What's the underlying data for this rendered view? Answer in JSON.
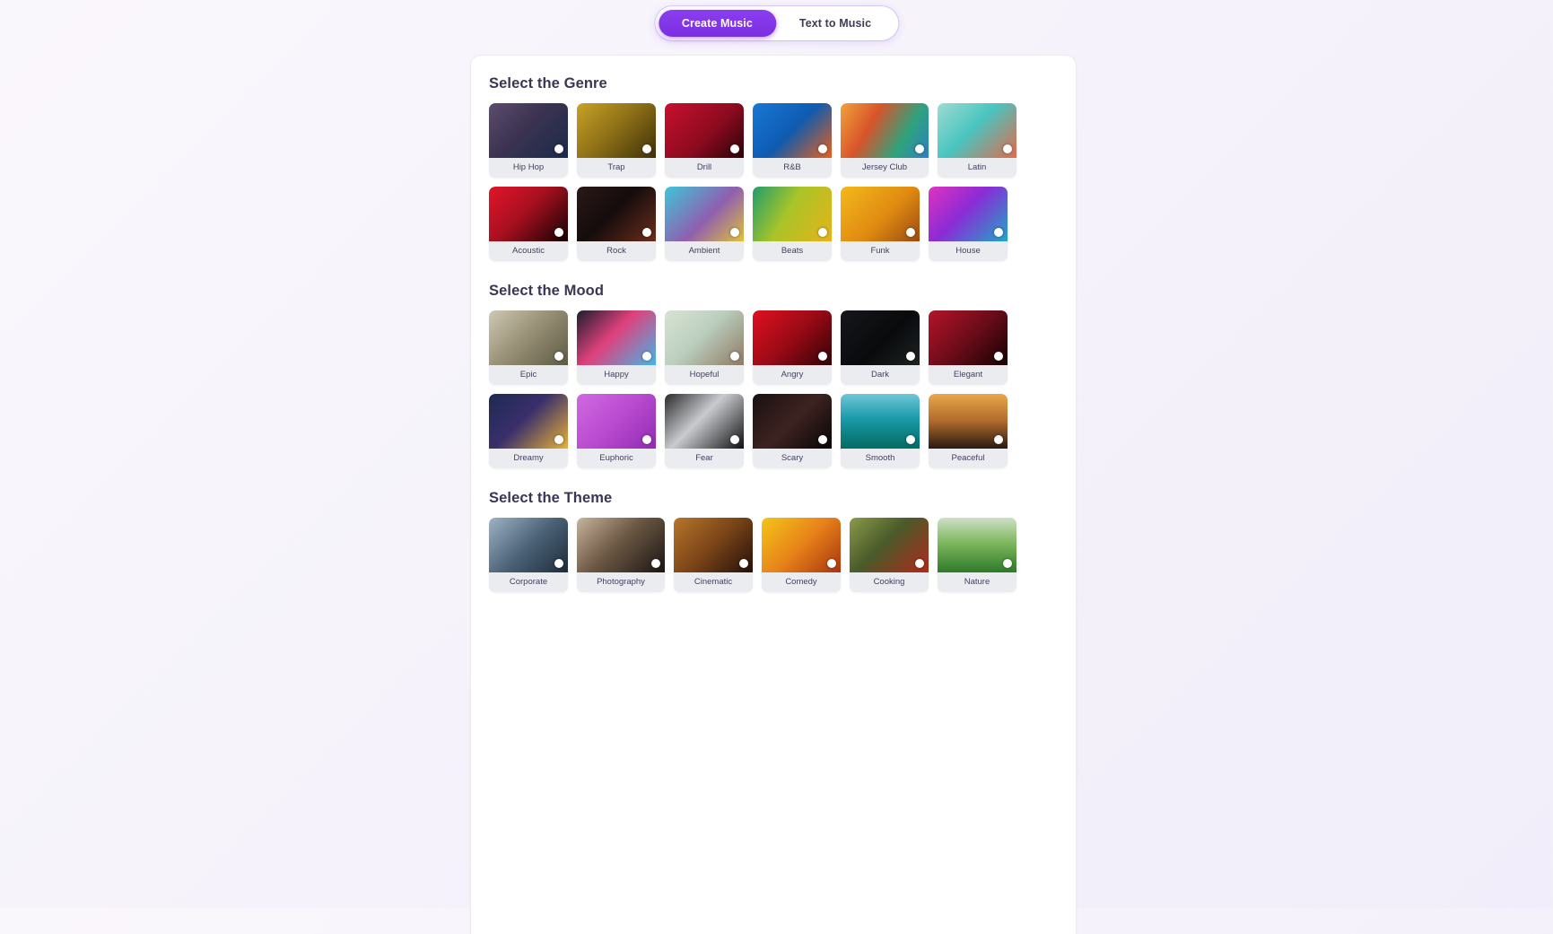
{
  "toggle": {
    "options": [
      {
        "label": "Create Music",
        "active": true
      },
      {
        "label": "Text to Music",
        "active": false
      }
    ]
  },
  "sections": [
    {
      "id": "genre",
      "title": "Select the Genre",
      "items": [
        {
          "label": "Hip Hop",
          "art": "linear-gradient(135deg,#5d4b6e 0%,#3b3350 45%,#1b2a4a 100%)"
        },
        {
          "label": "Trap",
          "art": "linear-gradient(135deg,#c9a227 0%,#8a6d16 50%,#3d3008 100%)"
        },
        {
          "label": "Drill",
          "art": "linear-gradient(135deg,#c8102e 0%,#8d0b1f 55%,#2b0209 100%)"
        },
        {
          "label": "R&B",
          "art": "linear-gradient(135deg,#1877d6 0%,#0f5bb0 50%,#e8601c 100%)"
        },
        {
          "label": "Jersey Club",
          "art": "linear-gradient(120deg,#f0a23c 0%,#d8542a 35%,#2fa37c 70%,#2f7fc0 100%)"
        },
        {
          "label": "Latin",
          "art": "linear-gradient(135deg,#9ddcd2 0%,#49c4c0 45%,#e26a4a 100%)"
        },
        {
          "label": "Acoustic",
          "art": "linear-gradient(135deg,#e2152a 0%,#a8101f 45%,#140103 100%)"
        },
        {
          "label": "Rock",
          "art": "linear-gradient(135deg,#2a1a18 0%,#140c0c 45%,#6b2d1c 100%)"
        },
        {
          "label": "Ambient",
          "art": "linear-gradient(135deg,#3ec6d8 0%,#8f5fb0 55%,#e0c13a 100%)"
        },
        {
          "label": "Beats",
          "art": "linear-gradient(120deg,#1f9e6a 0%,#a9c428 45%,#e8b21a 100%)"
        },
        {
          "label": "Funk",
          "art": "linear-gradient(135deg,#f4b91a 0%,#e08a12 55%,#9a4a10 100%)"
        },
        {
          "label": "House",
          "art": "linear-gradient(135deg,#e033c0 0%,#8a2bd6 45%,#1fa8c8 100%)"
        }
      ]
    },
    {
      "id": "mood",
      "title": "Select the Mood",
      "items": [
        {
          "label": "Epic",
          "art": "linear-gradient(135deg,#cfc9b4 0%,#9a9278 45%,#5d5a44 100%)"
        },
        {
          "label": "Happy",
          "art": "linear-gradient(135deg,#1b1d2e 0%,#e0417c 45%,#43b6e8 100%)"
        },
        {
          "label": "Hopeful",
          "art": "linear-gradient(135deg,#d8e3d2 0%,#bcd0c0 45%,#8e7a63 100%)"
        },
        {
          "label": "Angry",
          "art": "linear-gradient(135deg,#e01020 0%,#9a0a16 50%,#320206 100%)"
        },
        {
          "label": "Dark",
          "art": "linear-gradient(135deg,#15171a 0%,#090a0c 55%,#1d2420 100%)"
        },
        {
          "label": "Elegant",
          "art": "linear-gradient(135deg,#b3152a 0%,#6d0c19 50%,#130204 100%)"
        },
        {
          "label": "Dreamy",
          "art": "linear-gradient(135deg,#1d2a52 0%,#3a2f6b 45%,#e8b238 100%)"
        },
        {
          "label": "Euphoric",
          "art": "linear-gradient(135deg,#d06ae0 0%,#b94ad0 50%,#8f2cb0 100%)"
        },
        {
          "label": "Fear",
          "art": "linear-gradient(135deg,#2a2a2c 0%,#c9cbce 45%,#101012 100%)"
        },
        {
          "label": "Scary",
          "art": "linear-gradient(135deg,#1a1112 0%,#3c2320 50%,#0a0506 100%)"
        },
        {
          "label": "Smooth",
          "art": "linear-gradient(180deg,#6fc7d8 0%,#1a9aa8 45%,#036b62 100%)"
        },
        {
          "label": "Peaceful",
          "art": "linear-gradient(180deg,#e8a84a 0%,#b06a2c 50%,#2a1a12 100%)"
        }
      ]
    },
    {
      "id": "theme",
      "title": "Select the Theme",
      "items": [
        {
          "label": "Corporate",
          "art": "linear-gradient(135deg,#9fb2c4 0%,#4c6378 50%,#1d2b38 100%)"
        },
        {
          "label": "Photography",
          "art": "linear-gradient(135deg,#c7b49c 0%,#6e5a46 45%,#1a1512 100%)"
        },
        {
          "label": "Cinematic",
          "art": "linear-gradient(135deg,#b8762c 0%,#7a4418 50%,#241009 100%)"
        },
        {
          "label": "Comedy",
          "art": "linear-gradient(135deg,#f2c618 0%,#e8821a 50%,#a8350e 100%)"
        },
        {
          "label": "Cooking",
          "art": "linear-gradient(135deg,#8a9a4a 0%,#4a5a2a 45%,#b02a1a 100%)"
        },
        {
          "label": "Nature",
          "art": "linear-gradient(180deg,#cfe0c8 0%,#7fb85e 45%,#2e7a2a 100%)"
        }
      ]
    }
  ]
}
